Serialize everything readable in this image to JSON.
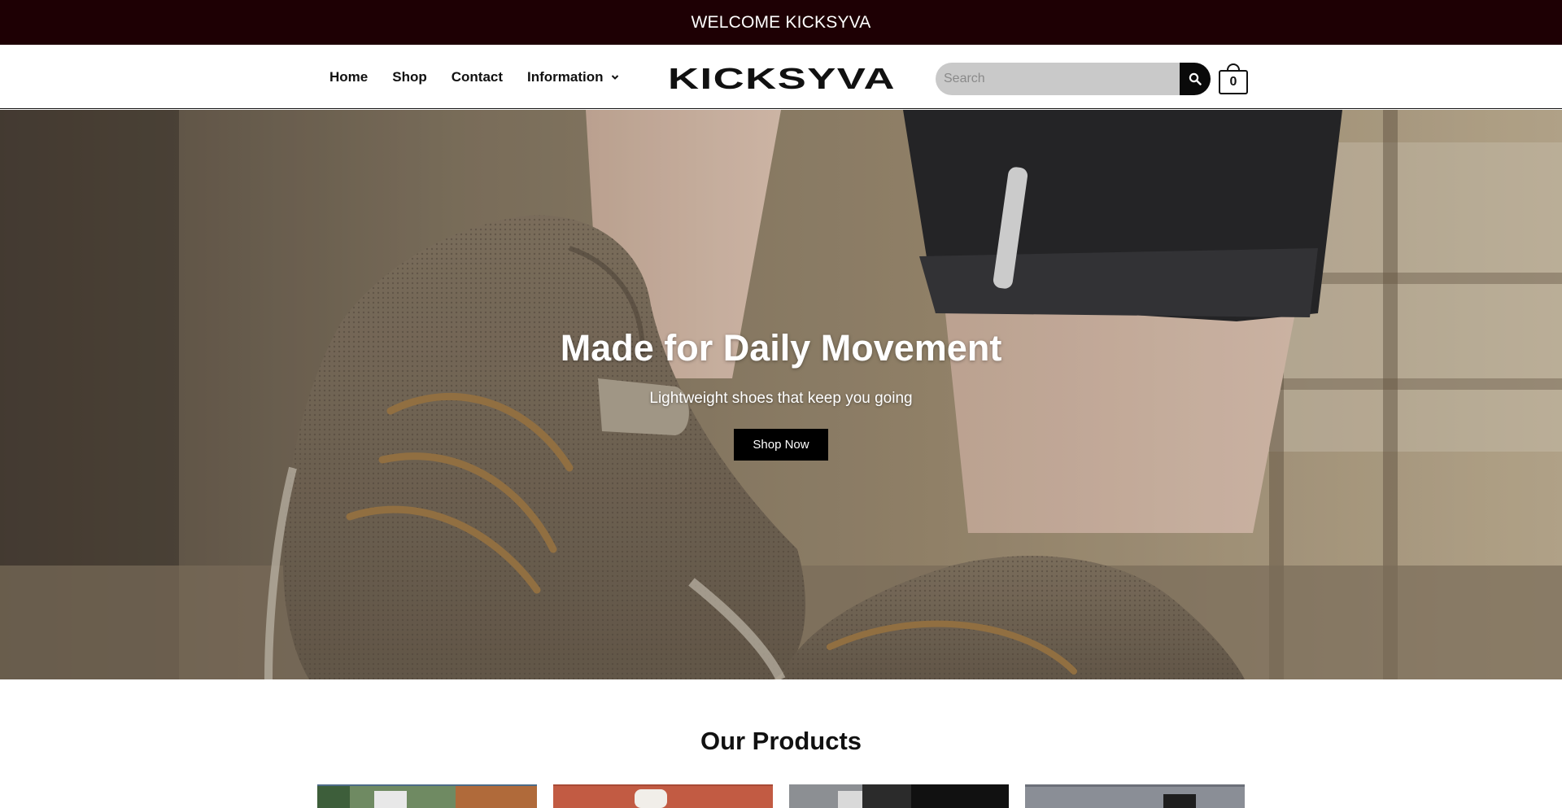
{
  "announcement": {
    "text": "WELCOME KICKSYVA"
  },
  "header": {
    "nav": [
      {
        "label": "Home"
      },
      {
        "label": "Shop"
      },
      {
        "label": "Contact"
      },
      {
        "label": "Information",
        "has_dropdown": true
      }
    ],
    "logo_text": "KICKSYVA",
    "search": {
      "placeholder": "Search",
      "value": ""
    },
    "cart": {
      "count": "0"
    }
  },
  "hero": {
    "title": "Made for Daily Movement",
    "subtitle": "Lightweight shoes that keep you going",
    "button_label": "Shop Now"
  },
  "products": {
    "title": "Our Products",
    "items": [
      {
        "image": "product-1-image"
      },
      {
        "image": "product-2-image"
      },
      {
        "image": "product-3-image"
      },
      {
        "image": "product-4-image"
      }
    ]
  },
  "colors": {
    "announcement_bg": "#1e0004",
    "button_bg": "#000000",
    "search_bg": "#c9c9c9"
  }
}
